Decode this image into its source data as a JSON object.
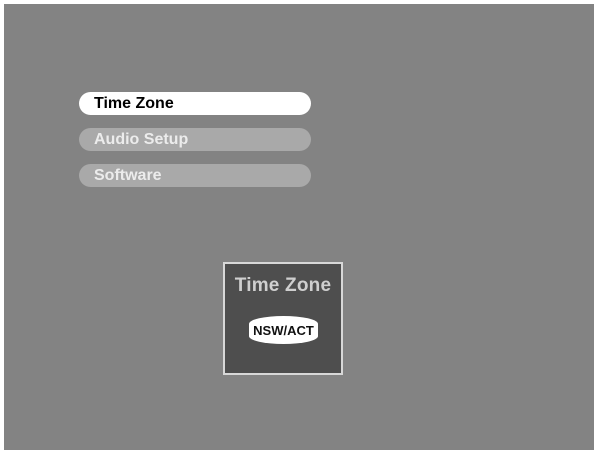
{
  "menu": {
    "items": [
      {
        "label": "Time Zone",
        "selected": true
      },
      {
        "label": "Audio Setup",
        "selected": false
      },
      {
        "label": "Software",
        "selected": false
      }
    ]
  },
  "panel": {
    "title": "Time Zone",
    "value": "NSW/ACT"
  },
  "colors": {
    "screen_background": "#838383",
    "selected_item": "#ffffff",
    "unselected_item": "#a9a9a9",
    "panel_background": "#4e4e4e",
    "panel_border": "#d8d8d8"
  }
}
